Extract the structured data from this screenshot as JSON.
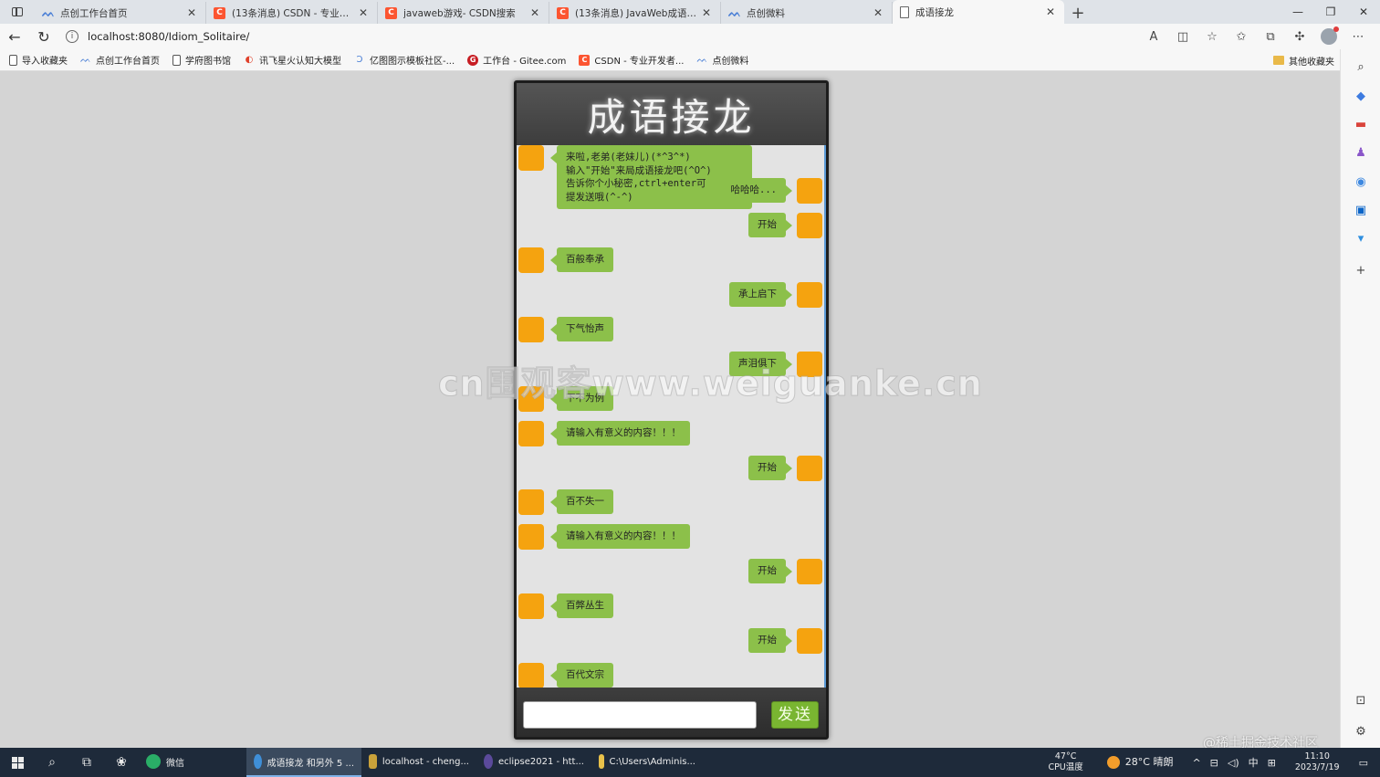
{
  "browser": {
    "tabs": [
      {
        "title": "点创工作台首页",
        "icon": "blue-logo"
      },
      {
        "title": "(13条消息) CSDN - 专业开发者社",
        "icon": "csdn"
      },
      {
        "title": "javaweb游戏- CSDN搜索",
        "icon": "csdn"
      },
      {
        "title": "(13条消息) JavaWeb成语接龙小游",
        "icon": "csdn"
      },
      {
        "title": "点创微料",
        "icon": "blue-logo"
      },
      {
        "title": "成语接龙",
        "icon": "page"
      }
    ],
    "url": "localhost:8080/Idiom_Solitaire/",
    "bookmarks": [
      {
        "label": "导入收藏夹",
        "icon": "import"
      },
      {
        "label": "点创工作台首页",
        "icon": "blue-logo"
      },
      {
        "label": "学府图书馆",
        "icon": "page"
      },
      {
        "label": "讯飞星火认知大模型",
        "icon": "spark"
      },
      {
        "label": "亿图图示模板社区-...",
        "icon": "blue-logo"
      },
      {
        "label": "工作台 - Gitee.com",
        "icon": "gitee"
      },
      {
        "label": "CSDN - 专业开发者...",
        "icon": "csdn"
      },
      {
        "label": "点创微料",
        "icon": "blue-logo"
      }
    ],
    "other_bookmarks": "其他收藏夹"
  },
  "chat": {
    "title": "成语接龙",
    "send_label": "发送",
    "input_value": "",
    "messages": [
      {
        "side": "left",
        "text": "来啦,老弟(老妹儿)(*^3^*)\n输入\"开始\"来局成语接龙吧(^O^)\n告诉你个小秘密,ctrl+enter可\n提发送哦(^-^)"
      },
      {
        "side": "right",
        "text": "哈哈哈..."
      },
      {
        "side": "right",
        "text": "开始"
      },
      {
        "side": "left",
        "text": "百般奉承"
      },
      {
        "side": "right",
        "text": "承上启下"
      },
      {
        "side": "left",
        "text": "下气怡声"
      },
      {
        "side": "right",
        "text": "声泪俱下"
      },
      {
        "side": "left",
        "text": "下不为例"
      },
      {
        "side": "left",
        "text": "请输入有意义的内容！！！"
      },
      {
        "side": "right",
        "text": "开始"
      },
      {
        "side": "left",
        "text": "百不失一"
      },
      {
        "side": "left",
        "text": "请输入有意义的内容！！！"
      },
      {
        "side": "right",
        "text": "开始"
      },
      {
        "side": "left",
        "text": "百弊丛生"
      },
      {
        "side": "right",
        "text": "开始"
      },
      {
        "side": "left",
        "text": "百代文宗"
      }
    ]
  },
  "watermarks": {
    "center": "cn围观客www.weiguanke.cn",
    "corner": "@稀土掘金技术社区"
  },
  "taskbar": {
    "apps": [
      {
        "label": "微信",
        "color": "#2aae67"
      },
      {
        "label": "成语接龙 和另外 5 ...",
        "color": "#3f8fd8",
        "active": true
      },
      {
        "label": "localhost - cheng...",
        "color": "#c9a23a"
      },
      {
        "label": "eclipse2021 - htt...",
        "color": "#5b4a9b"
      },
      {
        "label": "C:\\Users\\Adminis...",
        "color": "#e8c14a"
      }
    ],
    "cpu_temp": "47°C",
    "cpu_label": "CPU温度",
    "weather": "28°C 晴朗",
    "ime": "中",
    "time": "11:10",
    "date": "2023/7/19"
  }
}
